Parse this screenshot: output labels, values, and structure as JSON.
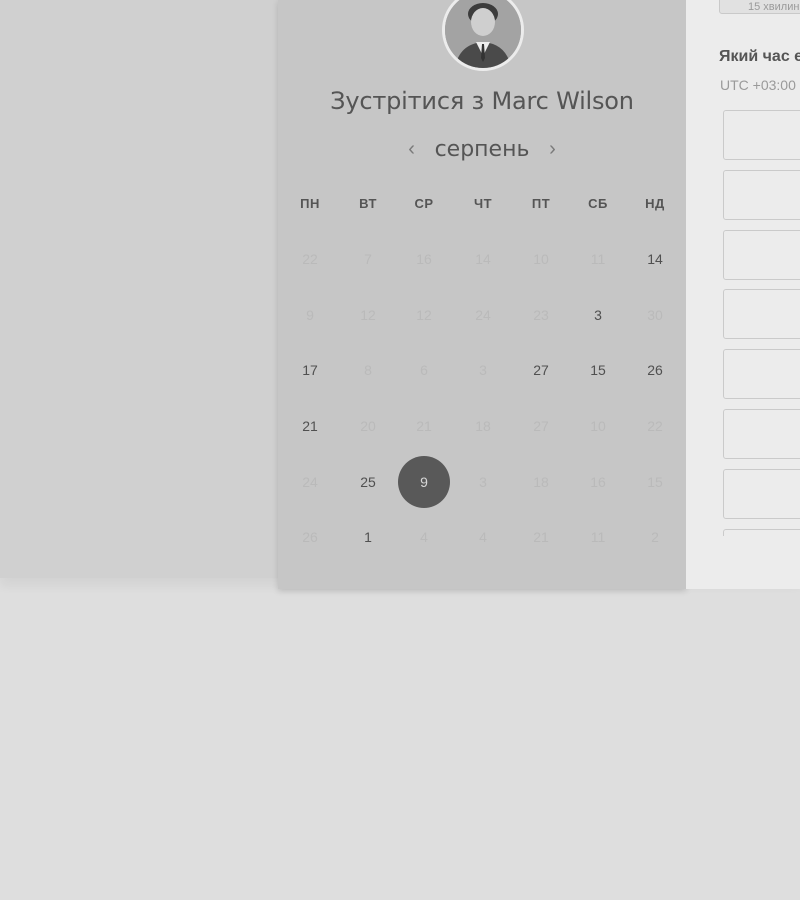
{
  "calendar": {
    "title_prefix": "Зустрітися з",
    "host_name": "Marc Wilson",
    "month": "серпень",
    "prev_icon": "‹",
    "next_icon": "›",
    "weekdays": [
      "ПН",
      "ВТ",
      "СР",
      "ЧТ",
      "ПТ",
      "СБ",
      "НД"
    ],
    "weeks": [
      [
        {
          "d": "22",
          "available": false
        },
        {
          "d": "7",
          "available": false
        },
        {
          "d": "16",
          "available": false
        },
        {
          "d": "14",
          "available": false
        },
        {
          "d": "10",
          "available": false
        },
        {
          "d": "11",
          "available": false
        },
        {
          "d": "14",
          "available": true
        }
      ],
      [
        {
          "d": "9",
          "available": false
        },
        {
          "d": "12",
          "available": false
        },
        {
          "d": "12",
          "available": false
        },
        {
          "d": "24",
          "available": false
        },
        {
          "d": "23",
          "available": false
        },
        {
          "d": "3",
          "available": true
        },
        {
          "d": "30",
          "available": false
        }
      ],
      [
        {
          "d": "17",
          "available": true
        },
        {
          "d": "8",
          "available": false
        },
        {
          "d": "6",
          "available": false
        },
        {
          "d": "3",
          "available": false
        },
        {
          "d": "27",
          "available": true
        },
        {
          "d": "15",
          "available": true
        },
        {
          "d": "26",
          "available": true
        }
      ],
      [
        {
          "d": "21",
          "available": true
        },
        {
          "d": "20",
          "available": false
        },
        {
          "d": "21",
          "available": false
        },
        {
          "d": "18",
          "available": false
        },
        {
          "d": "27",
          "available": false
        },
        {
          "d": "10",
          "available": false
        },
        {
          "d": "22",
          "available": false
        }
      ],
      [
        {
          "d": "24",
          "available": false
        },
        {
          "d": "25",
          "available": true
        },
        {
          "d": "9",
          "available": true,
          "selected": true
        },
        {
          "d": "3",
          "available": false
        },
        {
          "d": "18",
          "available": false
        },
        {
          "d": "16",
          "available": false
        },
        {
          "d": "15",
          "available": false
        }
      ],
      [
        {
          "d": "26",
          "available": false
        },
        {
          "d": "1",
          "available": true
        },
        {
          "d": "4",
          "available": false
        },
        {
          "d": "4",
          "available": false
        },
        {
          "d": "21",
          "available": false
        },
        {
          "d": "11",
          "available": false
        },
        {
          "d": "2",
          "available": false
        }
      ]
    ]
  },
  "booking": {
    "duration_label": "15 хвилин",
    "time_question": "Який час е",
    "timezone": "UTC +03:00",
    "slot_count": 8
  },
  "colors": {
    "overlay_dark": "#595959",
    "available_text": "#505050",
    "unavailable_text": "#bababa"
  }
}
